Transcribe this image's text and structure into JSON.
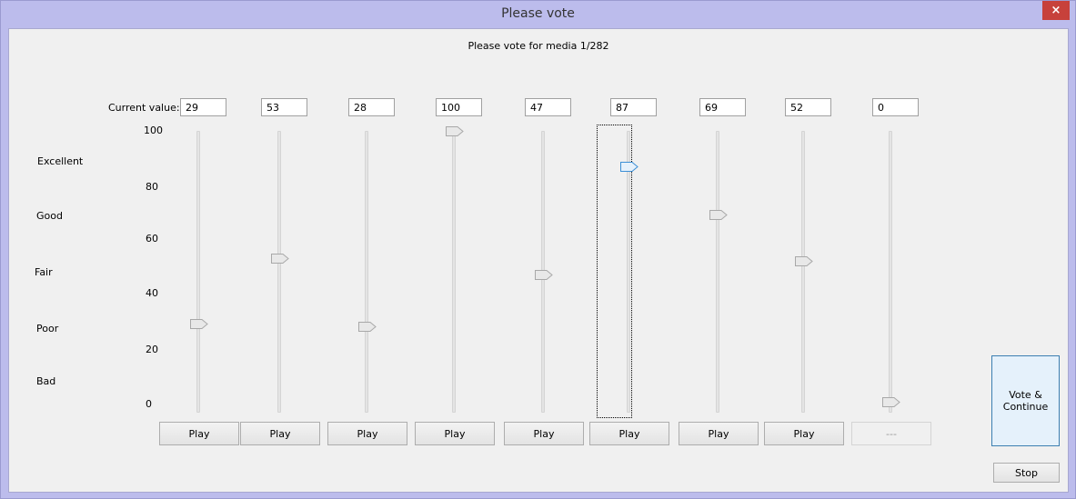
{
  "window": {
    "title": "Please vote",
    "close_icon": "×"
  },
  "header": "Please vote for media 1/282",
  "current_value_label": "Current value:",
  "scale": {
    "ticks": [
      "100",
      "80",
      "60",
      "40",
      "20",
      "0"
    ],
    "ratings": [
      "Excellent",
      "Good",
      "Fair",
      "Poor",
      "Bad"
    ]
  },
  "sliders": [
    {
      "value": "29",
      "level": 29,
      "play": "Play",
      "enabled": true
    },
    {
      "value": "53",
      "level": 53,
      "play": "Play",
      "enabled": true
    },
    {
      "value": "28",
      "level": 28,
      "play": "Play",
      "enabled": true
    },
    {
      "value": "100",
      "level": 100,
      "play": "Play",
      "enabled": true
    },
    {
      "value": "47",
      "level": 47,
      "play": "Play",
      "enabled": true
    },
    {
      "value": "87",
      "level": 87,
      "play": "Play",
      "enabled": true,
      "focused": true
    },
    {
      "value": "69",
      "level": 69,
      "play": "Play",
      "enabled": true
    },
    {
      "value": "52",
      "level": 52,
      "play": "Play",
      "enabled": true
    },
    {
      "value": "0",
      "level": 0,
      "play": "---",
      "enabled": false
    }
  ],
  "buttons": {
    "vote_continue": "Vote &\nContinue",
    "stop": "Stop"
  },
  "colors": {
    "focused_thumb": "#3c8fd6",
    "thumb": "#cfcfcf",
    "vote_border": "#3c7fb1"
  }
}
